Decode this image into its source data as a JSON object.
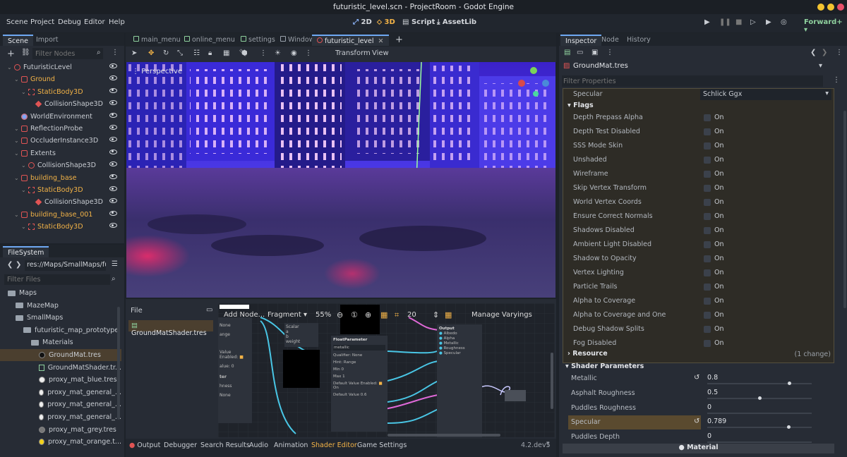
{
  "window": {
    "title": "futuristic_level.scn - ProjectRoom - Godot Engine"
  },
  "menu": [
    "Scene",
    "Project",
    "Debug",
    "Editor",
    "Help"
  ],
  "modes": {
    "m2d": "2D",
    "m3d": "3D",
    "script": "Script",
    "assetlib": "AssetLib"
  },
  "renderer": "Forward+",
  "scene_dock": {
    "tabs": [
      "Scene",
      "Import"
    ],
    "filter_placeholder": "Filter Nodes",
    "nodes": [
      {
        "label": "FuturisticLevel",
        "indent": 0,
        "icon": "circle"
      },
      {
        "label": "Ground",
        "indent": 1,
        "icon": "square"
      },
      {
        "label": "StaticBody3D",
        "indent": 2,
        "icon": "dash"
      },
      {
        "label": "CollisionShape3D",
        "indent": 3,
        "icon": "cube"
      },
      {
        "label": "WorldEnvironment",
        "indent": 1,
        "icon": "globe"
      },
      {
        "label": "ReflectionProbe",
        "indent": 1,
        "icon": "square"
      },
      {
        "label": "OccluderInstance3D",
        "indent": 1,
        "icon": "square"
      },
      {
        "label": "Extents",
        "indent": 1,
        "icon": "square"
      },
      {
        "label": "CollisionShape3D",
        "indent": 2,
        "icon": "circle"
      },
      {
        "label": "building_base",
        "indent": 1,
        "icon": "square"
      },
      {
        "label": "StaticBody3D",
        "indent": 2,
        "icon": "dash"
      },
      {
        "label": "CollisionShape3D",
        "indent": 3,
        "icon": "cube"
      },
      {
        "label": "building_base_001",
        "indent": 1,
        "icon": "square"
      },
      {
        "label": "StaticBody3D",
        "indent": 2,
        "icon": "dash"
      }
    ]
  },
  "filesystem": {
    "tab": "FileSystem",
    "path": "res://Maps/SmallMaps/futu",
    "filter_placeholder": "Filter Files",
    "entries": [
      {
        "label": "Maps",
        "indent": 1,
        "type": "folder"
      },
      {
        "label": "MazeMap",
        "indent": 2,
        "type": "folder"
      },
      {
        "label": "SmallMaps",
        "indent": 2,
        "type": "folder"
      },
      {
        "label": "futuristic_map_prototype",
        "indent": 3,
        "type": "folder"
      },
      {
        "label": "Materials",
        "indent": 4,
        "type": "folder"
      },
      {
        "label": "GroundMat.tres",
        "indent": 5,
        "type": "ball",
        "color": "#111111",
        "selected": true
      },
      {
        "label": "GroundMatShader.tr...",
        "indent": 5,
        "type": "shader"
      },
      {
        "label": "proxy_mat_blue.tres",
        "indent": 5,
        "type": "ball",
        "color": "#eeeeee"
      },
      {
        "label": "proxy_mat_general_...",
        "indent": 5,
        "type": "ball",
        "color": "#eeeeee"
      },
      {
        "label": "proxy_mat_general_...",
        "indent": 5,
        "type": "ball",
        "color": "#eeeeee"
      },
      {
        "label": "proxy_mat_general_...",
        "indent": 5,
        "type": "ball",
        "color": "#eeeeee"
      },
      {
        "label": "proxy_mat_grey.tres",
        "indent": 5,
        "type": "ball",
        "color": "#777777"
      },
      {
        "label": "proxy_mat_orange.t...",
        "indent": 5,
        "type": "ball",
        "color": "#f2d21b"
      }
    ]
  },
  "editor_tabs": [
    {
      "label": "main_menu",
      "color": "#8fd19e"
    },
    {
      "label": "online_menu",
      "color": "#8fd19e"
    },
    {
      "label": "settings",
      "color": "#8fd19e"
    },
    {
      "label": "Window",
      "color": "#9aa3ad"
    },
    {
      "label": "futuristic_level",
      "color": "#e05454",
      "active": true
    }
  ],
  "viewport": {
    "perspective": "Perspective",
    "transform": "Transform",
    "view": "View"
  },
  "shader_editor": {
    "file_label": "File",
    "file_name": "GroundMatShader.tres",
    "add_node": "Add Node...",
    "mode": "Fragment",
    "zoom": "55%",
    "snap": "20",
    "manage_varyings": "Manage Varyings",
    "float_param": {
      "title": "FloatParameter",
      "name": "metallic",
      "qualifier": "Qualifier:",
      "qualifier_val": "None",
      "hint": "Hint:",
      "hint_val": "Range",
      "min": "Min",
      "min_val": "0",
      "max": "Max",
      "max_val": "1",
      "default_enabled": "Default Value Enabled:",
      "default_on": "On",
      "default_value": "Default Value",
      "default_val": "0.6"
    },
    "output": {
      "title": "Output",
      "ports": [
        "Albedo",
        "Alpha",
        "Metallic",
        "Roughness",
        "Specular"
      ]
    },
    "version": "4.2.dev5"
  },
  "bottom_tabs": [
    "Output",
    "Debugger",
    "Search Results",
    "Audio",
    "Animation",
    "Shader Editor",
    "Game Settings"
  ],
  "inspector": {
    "tabs": [
      "Inspector",
      "Node",
      "History"
    ],
    "resource": "GroundMat.tres",
    "filter_placeholder": "Filter Properties",
    "specular_label": "Specular",
    "specular_value": "Schlick Ggx",
    "flags_section": "Flags",
    "flags": [
      "Depth Prepass Alpha",
      "Depth Test Disabled",
      "SSS Mode Skin",
      "Unshaded",
      "Wireframe",
      "Skip Vertex Transform",
      "World Vertex Coords",
      "Ensure Correct Normals",
      "Shadows Disabled",
      "Ambient Light Disabled",
      "Shadow to Opacity",
      "Vertex Lighting",
      "Particle Trails",
      "Alpha to Coverage",
      "Alpha to Coverage and One",
      "Debug Shadow Splits",
      "Fog Disabled"
    ],
    "flag_value": "On",
    "resource_section": "Resource",
    "resource_change": "(1 change)",
    "shader_params_section": "Shader Parameters",
    "shader_params": [
      {
        "label": "Metallic",
        "value": "0.8",
        "fraction": 0.8,
        "revert": true
      },
      {
        "label": "Asphalt Roughness",
        "value": "0.5",
        "fraction": 0.5
      },
      {
        "label": "Puddles Roughness",
        "value": "0",
        "fraction": 0
      },
      {
        "label": "Specular",
        "value": "0.789",
        "fraction": 0.789,
        "revert": true,
        "highlighted": true
      },
      {
        "label": "Puddles Depth",
        "value": "0",
        "fraction": 0
      }
    ],
    "material_section": "Material"
  }
}
